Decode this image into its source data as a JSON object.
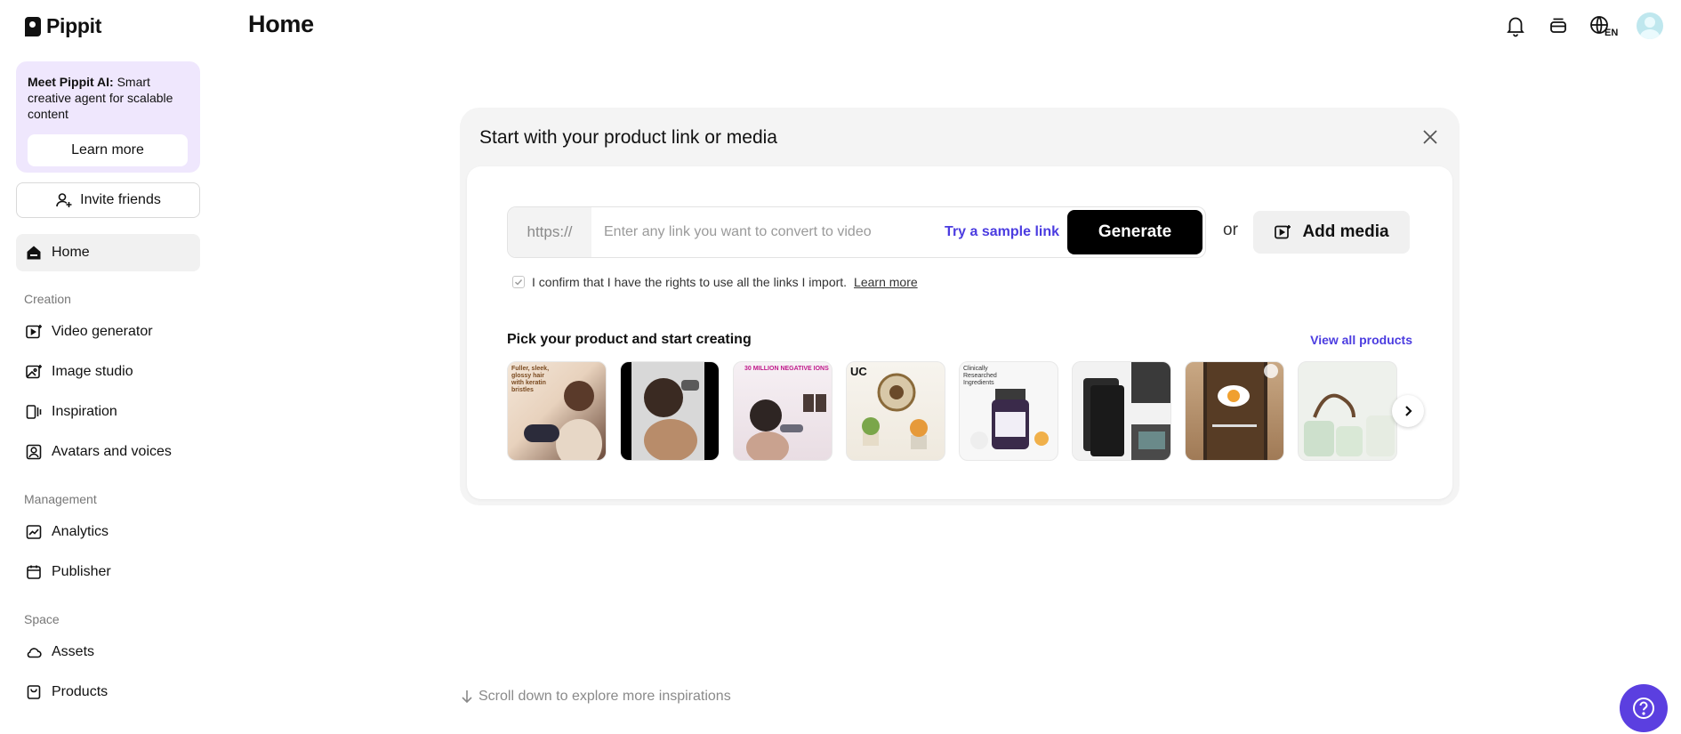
{
  "app": {
    "name": "Pippit"
  },
  "sidebar": {
    "promo": {
      "title": "Meet Pippit AI:",
      "text": "Smart creative agent for scalable content",
      "button": "Learn more"
    },
    "invite": "Invite friends",
    "home": "Home",
    "sections": {
      "creation": "Creation",
      "management": "Management",
      "space": "Space"
    },
    "creation_items": [
      "Video generator",
      "Image studio",
      "Inspiration",
      "Avatars and voices"
    ],
    "management_items": [
      "Analytics",
      "Publisher"
    ],
    "space_items": [
      "Assets",
      "Products"
    ]
  },
  "header": {
    "title": "Home",
    "icons": [
      "bell-icon",
      "stack-icon",
      "globe-language-icon",
      "avatar"
    ],
    "language": "EN"
  },
  "card": {
    "title": "Start with your product link or media",
    "link_prefix": "https://",
    "link_placeholder": "Enter any link you want to convert to video",
    "sample_link": "Try a sample link",
    "generate": "Generate",
    "or": "or",
    "add_media": "Add media",
    "confirm_text": "I confirm that I have the rights to use all the links I import.",
    "confirm_link": "Learn more",
    "pick_title": "Pick your product and start creating",
    "view_all": "View all products",
    "thumb_captions": [
      "Fuller, sleek, glossy hair with keratin bristles",
      "",
      "30 MILLION NEGATIVE IONS",
      "UC",
      "Clinically Researched Ingredients",
      "",
      "",
      ""
    ]
  },
  "footer": {
    "scroll_hint": "Scroll down to explore more inspirations"
  },
  "colors": {
    "accent": "#4b3ce0",
    "help_button": "#5b3fe0",
    "promo_bg": "#efe7fd"
  }
}
